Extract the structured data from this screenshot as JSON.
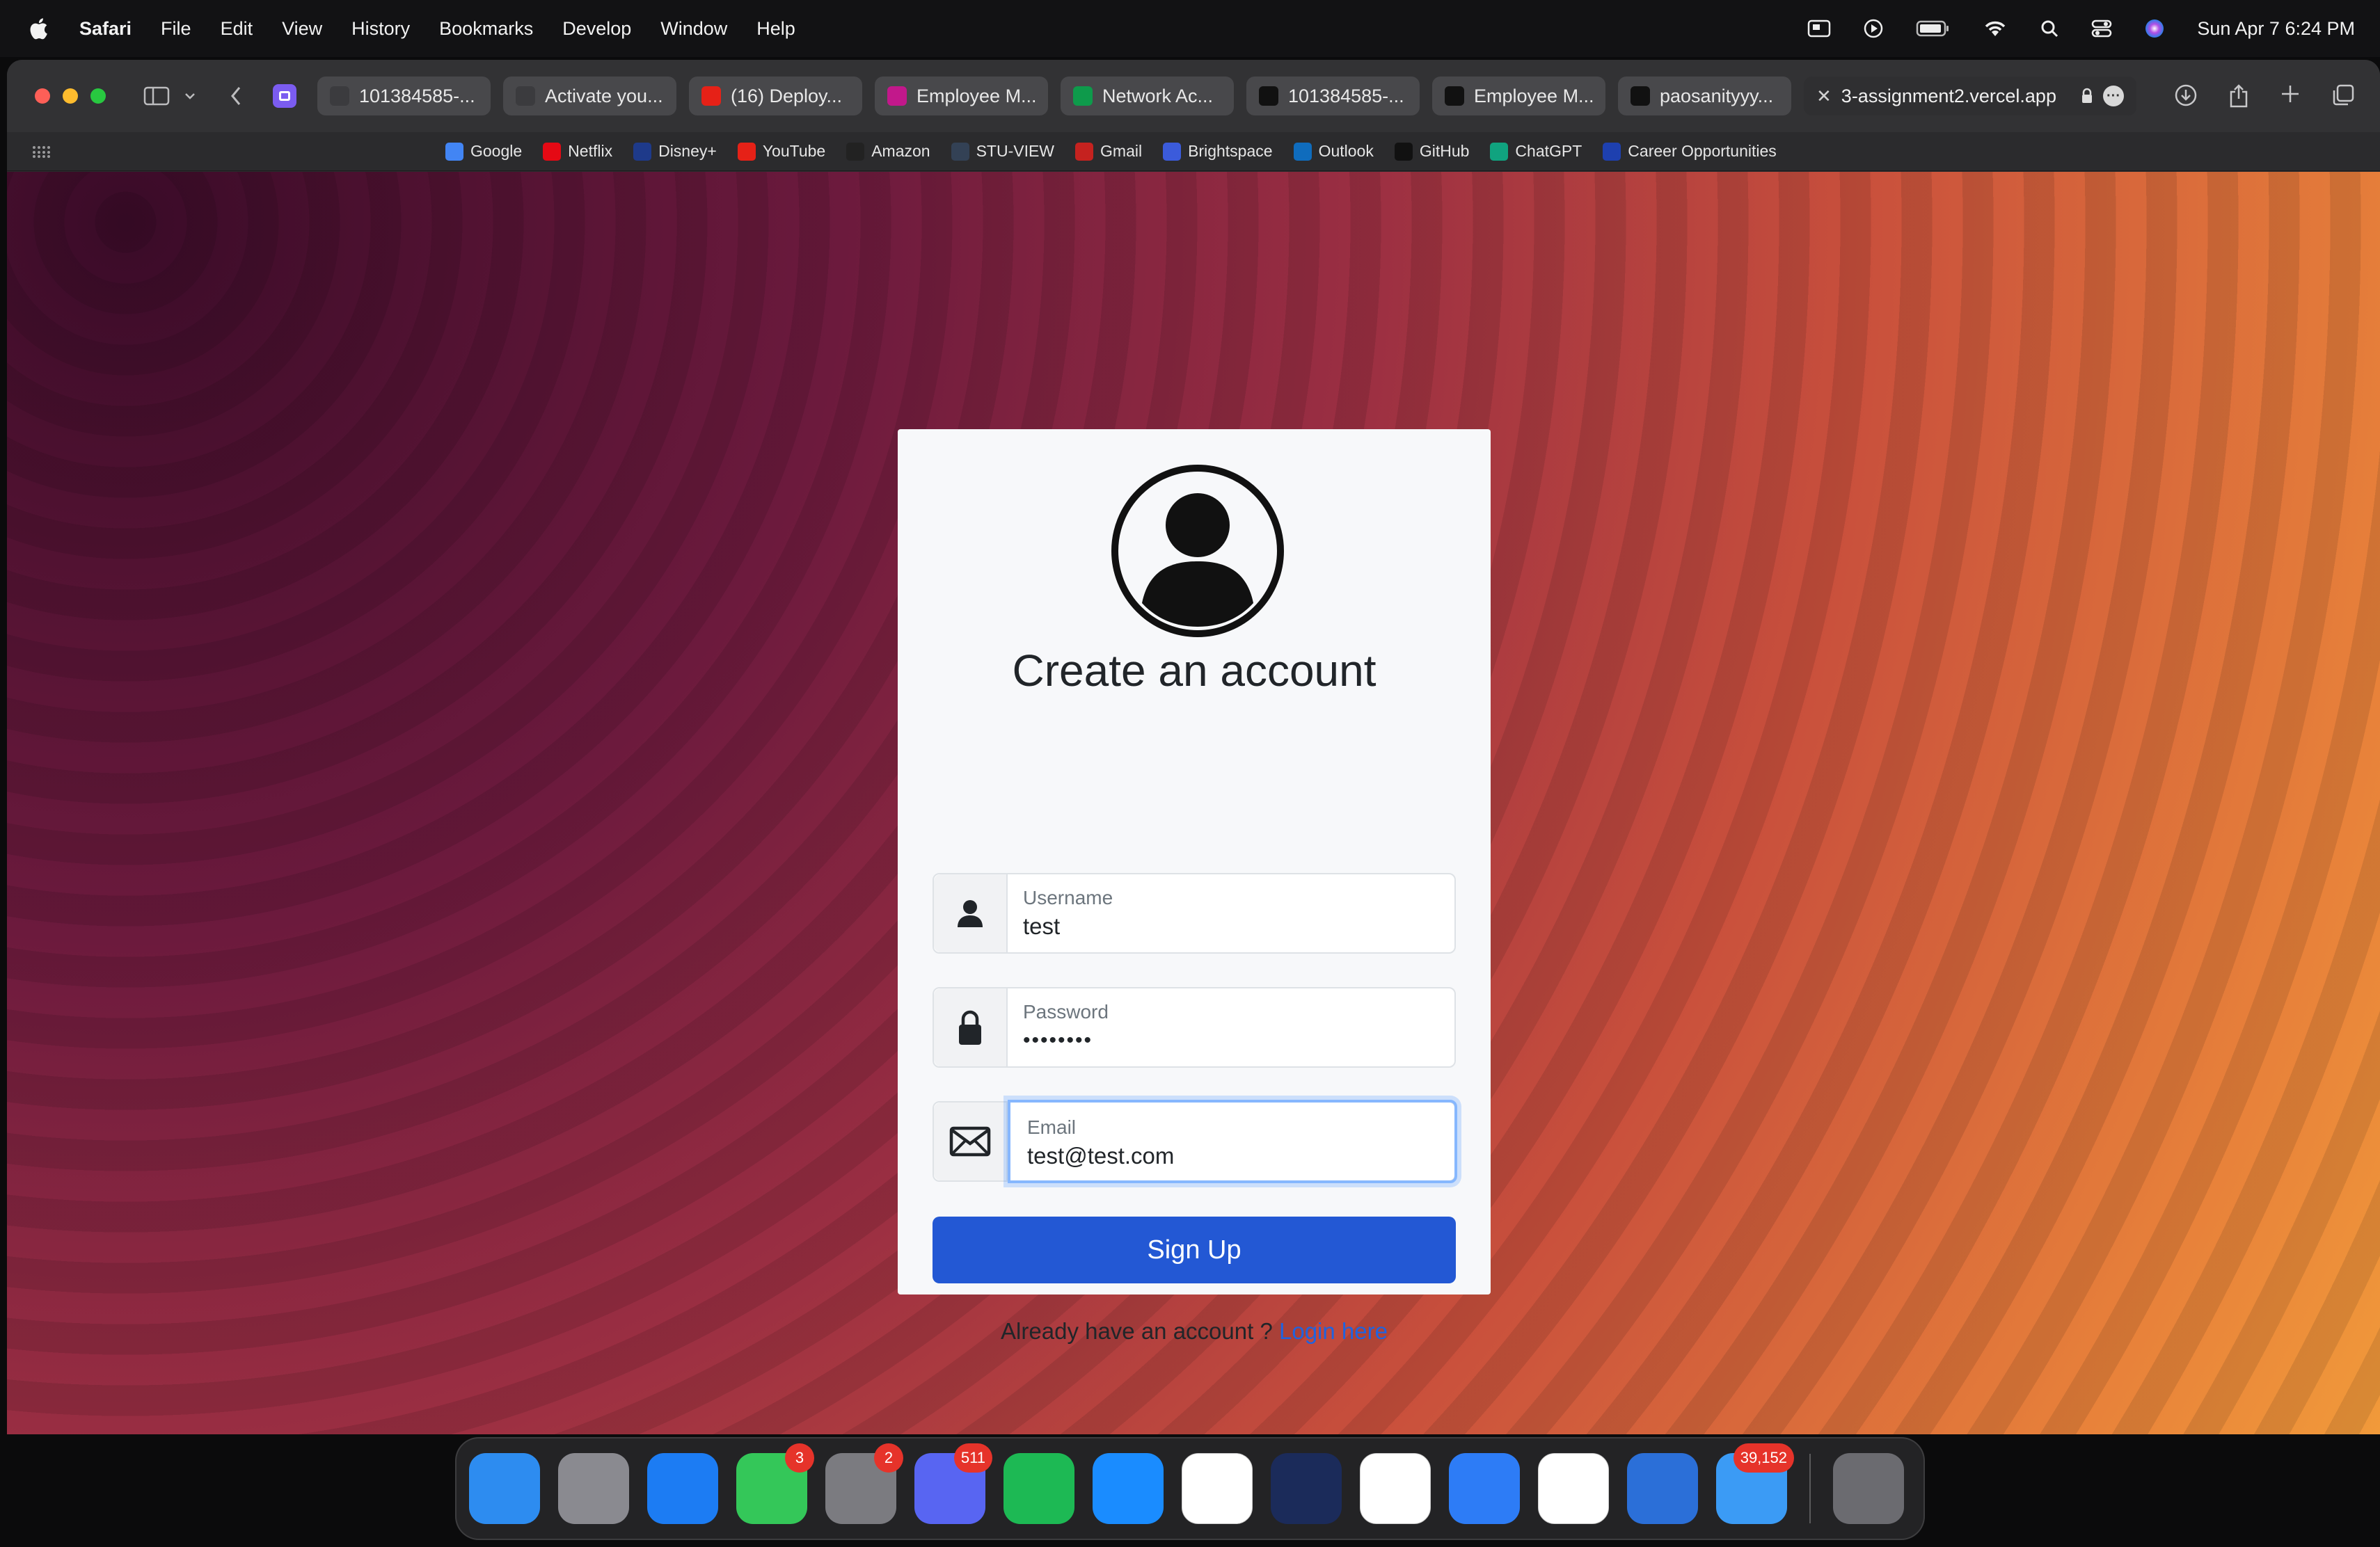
{
  "menubar": {
    "app": "Safari",
    "items": [
      "File",
      "Edit",
      "View",
      "History",
      "Bookmarks",
      "Develop",
      "Window",
      "Help"
    ],
    "clock": "Sun Apr 7  6:24 PM"
  },
  "tabs": [
    {
      "label": "101384585-...",
      "icon": "link-icon",
      "color": "#3b3b3e"
    },
    {
      "label": "Activate you...",
      "icon": "gmail-icon",
      "color": "#3b3b3e"
    },
    {
      "label": "(16) Deploy...",
      "icon": "youtube-icon",
      "color": "#e62117"
    },
    {
      "label": "Employee M...",
      "icon": "app-icon",
      "color": "#c2188b"
    },
    {
      "label": "Network Ac...",
      "icon": "mongodb-icon",
      "color": "#0e9a4b"
    },
    {
      "label": "101384585-...",
      "icon": "vercel-icon",
      "color": "#111111"
    },
    {
      "label": "Employee M...",
      "icon": "angular-icon",
      "color": "#111111"
    },
    {
      "label": "paosanityyy...",
      "icon": "github-icon",
      "color": "#111111"
    }
  ],
  "active_tab": {
    "label": "3-assignment2.vercel.app"
  },
  "bookmarks": [
    {
      "label": "Google",
      "icon": "google-icon",
      "color": "#4285f4"
    },
    {
      "label": "Netflix",
      "icon": "netflix-icon",
      "color": "#e50914"
    },
    {
      "label": "Disney+",
      "icon": "disney-icon",
      "color": "#1e3a8a"
    },
    {
      "label": "YouTube",
      "icon": "youtube-icon",
      "color": "#e62117"
    },
    {
      "label": "Amazon",
      "icon": "amazon-icon",
      "color": "#222222"
    },
    {
      "label": "STU-VIEW",
      "icon": "stuview-icon",
      "color": "#334155"
    },
    {
      "label": "Gmail",
      "icon": "gmail-icon",
      "color": "#c5221f"
    },
    {
      "label": "Brightspace",
      "icon": "brightspace-icon",
      "color": "#3b5bdb"
    },
    {
      "label": "Outlook",
      "icon": "outlook-icon",
      "color": "#0f6cbd"
    },
    {
      "label": "GitHub",
      "icon": "github-icon",
      "color": "#111111"
    },
    {
      "label": "ChatGPT",
      "icon": "chatgpt-icon",
      "color": "#10a37f"
    },
    {
      "label": "Career Opportunities",
      "icon": "career-icon",
      "color": "#1e40af"
    }
  ],
  "form": {
    "title": "Create an account",
    "username": {
      "label": "Username",
      "value": "test"
    },
    "password": {
      "label": "Password",
      "value": "••••••••"
    },
    "email": {
      "label": "Email",
      "value": "test@test.com"
    },
    "submit": "Sign Up",
    "footer_text": "Already have an account ? ",
    "footer_link": "Login here"
  },
  "colors": {
    "primary": "#2358d4",
    "link": "#1f63e0",
    "card": "#f7f8fa"
  },
  "dock": [
    {
      "name": "finder",
      "color": "#2d8cf0",
      "badge": ""
    },
    {
      "name": "launchpad",
      "color": "#8a8a90",
      "badge": ""
    },
    {
      "name": "app-store",
      "color": "#1c7cf3",
      "badge": ""
    },
    {
      "name": "facetime",
      "color": "#34c759",
      "badge": "3"
    },
    {
      "name": "system-settings",
      "color": "#7b7b80",
      "badge": "2"
    },
    {
      "name": "discord",
      "color": "#5865f2",
      "badge": "511"
    },
    {
      "name": "spotify",
      "color": "#1db954",
      "badge": ""
    },
    {
      "name": "safari",
      "color": "#1a8cff",
      "badge": ""
    },
    {
      "name": "google-docs",
      "color": "#ffffff",
      "badge": ""
    },
    {
      "name": "george-brown",
      "color": "#1b2b5a",
      "badge": ""
    },
    {
      "name": "google-slides",
      "color": "#ffffff",
      "badge": ""
    },
    {
      "name": "xcode",
      "color": "#2d7cf6",
      "badge": ""
    },
    {
      "name": "vscode",
      "color": "#ffffff",
      "badge": ""
    },
    {
      "name": "instruments",
      "color": "#2b6fd8",
      "badge": ""
    },
    {
      "name": "mail",
      "color": "#3b9bf5",
      "badge": "39,152"
    },
    {
      "name": "trash",
      "color": "#6b6b70",
      "badge": ""
    }
  ]
}
